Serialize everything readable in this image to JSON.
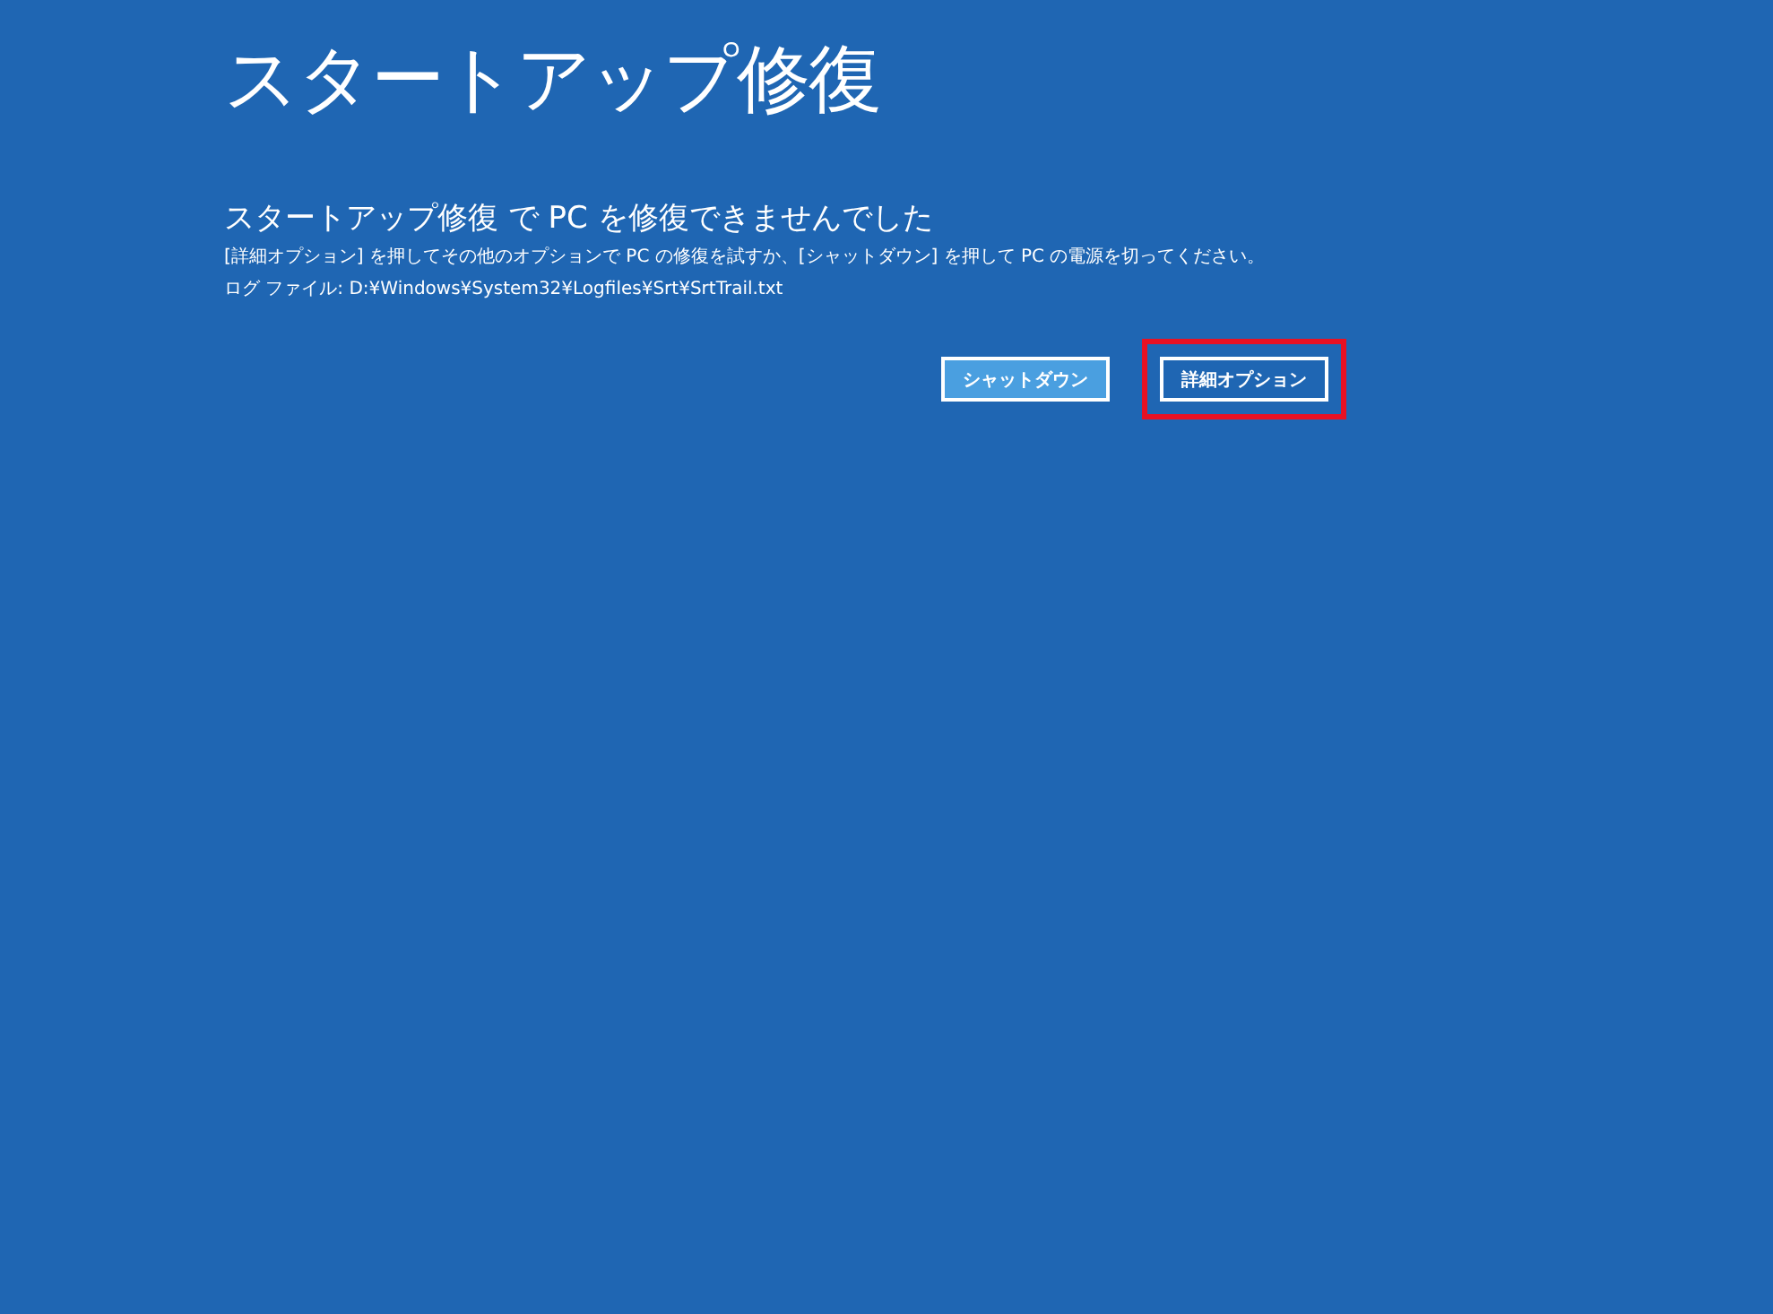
{
  "title": "スタートアップ修復",
  "message": {
    "heading": "スタートアップ修復 で PC を修復できませんでした",
    "body": "[詳細オプション] を押してその他のオプションで PC の修復を試すか、[シャットダウン] を押して PC の電源を切ってください。",
    "log": "ログ ファイル: D:¥Windows¥System32¥Logfiles¥Srt¥SrtTrail.txt"
  },
  "buttons": [
    {
      "label": "シャットダウン",
      "focused": true,
      "highlighted": false
    },
    {
      "label": "詳細オプション",
      "focused": false,
      "highlighted": true
    }
  ]
}
